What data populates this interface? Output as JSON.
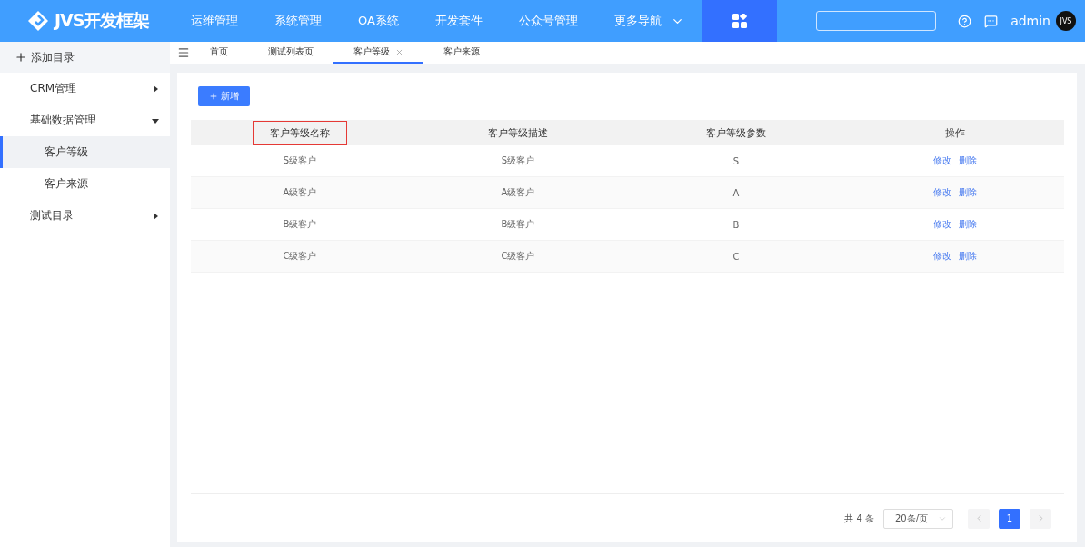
{
  "header": {
    "logo": "JVS开发框架",
    "nav": [
      {
        "label": "运维管理",
        "kind": "link"
      },
      {
        "label": "系统管理",
        "kind": "link"
      },
      {
        "label": "OA系统",
        "kind": "link"
      },
      {
        "label": "开发套件",
        "kind": "link"
      },
      {
        "label": "公众号管理",
        "kind": "link"
      },
      {
        "label": "更多导航",
        "kind": "dropdown"
      }
    ],
    "username": "admin",
    "avatar": "JVS"
  },
  "sidebar": {
    "add_label": "添加目录",
    "items": [
      {
        "label": "CRM管理",
        "expanded": false,
        "selected": false
      },
      {
        "label": "基础数据管理",
        "expanded": true,
        "selected": false,
        "children": [
          {
            "label": "客户等级",
            "selected": true
          },
          {
            "label": "客户来源",
            "selected": false
          }
        ]
      },
      {
        "label": "测试目录",
        "expanded": false,
        "selected": false
      }
    ]
  },
  "tabs": [
    {
      "label": "首页",
      "selected": false,
      "closable": false
    },
    {
      "label": "测试列表页",
      "selected": false,
      "closable": false
    },
    {
      "label": "客户等级",
      "selected": true,
      "closable": true
    },
    {
      "label": "客户来源",
      "selected": false,
      "closable": false
    }
  ],
  "add_button": "新增",
  "table": {
    "columns": [
      {
        "label": "客户等级名称",
        "highlighted": true
      },
      {
        "label": "客户等级描述",
        "highlighted": false
      },
      {
        "label": "客户等级参数",
        "highlighted": false
      },
      {
        "label": "操作",
        "highlighted": false
      }
    ],
    "rows": [
      {
        "cells": [
          "S级客户",
          "S级客户",
          "S"
        ],
        "actions": [
          "修改",
          "删除"
        ]
      },
      {
        "cells": [
          "A级客户",
          "A级客户",
          "A"
        ],
        "actions": [
          "修改",
          "删除"
        ]
      },
      {
        "cells": [
          "B级客户",
          "B级客户",
          "B"
        ],
        "actions": [
          "修改",
          "删除"
        ]
      },
      {
        "cells": [
          "C级客户",
          "C级客户",
          "C"
        ],
        "actions": [
          "修改",
          "删除"
        ]
      }
    ]
  },
  "pagination": {
    "total": "共 4 条",
    "page_size": "20条/页",
    "pages": [
      {
        "label": "1",
        "selected": true
      }
    ]
  }
}
